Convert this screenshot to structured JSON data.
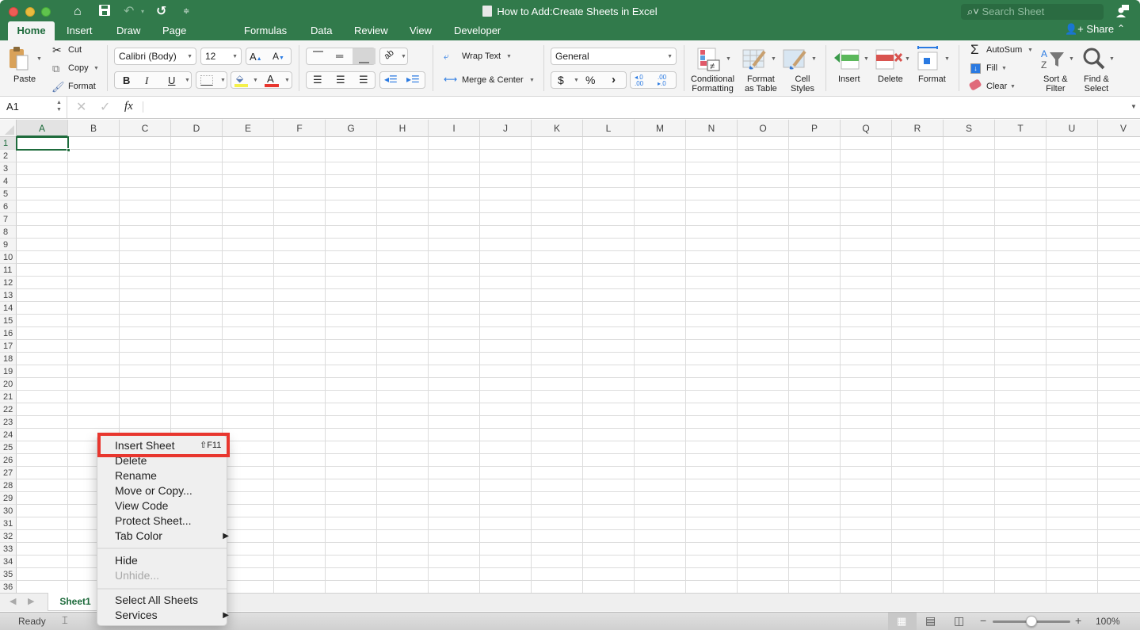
{
  "window": {
    "title": "How to Add:Create Sheets in Excel",
    "search_placeholder": "Search Sheet"
  },
  "quick_access": [
    "home-icon",
    "save-icon",
    "undo-icon",
    "redo-icon",
    "customize-icon"
  ],
  "tabs": [
    {
      "label": "Home",
      "active": true
    },
    {
      "label": "Insert"
    },
    {
      "label": "Draw"
    },
    {
      "label": "Page Layout"
    },
    {
      "label": "Formulas"
    },
    {
      "label": "Data"
    },
    {
      "label": "Review"
    },
    {
      "label": "View"
    },
    {
      "label": "Developer"
    }
  ],
  "share_label": "Share",
  "ribbon": {
    "paste": "Paste",
    "cut": "Cut",
    "copy": "Copy",
    "format_painter": "Format",
    "font_name": "Calibri (Body)",
    "font_size": "12",
    "bold": "B",
    "italic": "I",
    "underline": "U",
    "wrap_text": "Wrap Text",
    "merge_center": "Merge & Center",
    "number_format": "General",
    "currency": "$",
    "percent": "%",
    "comma": "›",
    "cond_format_1": "Conditional",
    "cond_format_2": "Formatting",
    "format_table_1": "Format",
    "format_table_2": "as Table",
    "cell_styles_1": "Cell",
    "cell_styles_2": "Styles",
    "insert": "Insert",
    "delete": "Delete",
    "format": "Format",
    "autosum": "AutoSum",
    "fill": "Fill",
    "clear": "Clear",
    "sort_1": "Sort &",
    "sort_2": "Filter",
    "find_1": "Find &",
    "find_2": "Select"
  },
  "formula_bar": {
    "name_box": "A1",
    "fx": "fx",
    "value": ""
  },
  "columns": [
    "A",
    "B",
    "C",
    "D",
    "E",
    "F",
    "G",
    "H",
    "I",
    "J",
    "K",
    "L",
    "M",
    "N",
    "O",
    "P",
    "Q",
    "R",
    "S",
    "T",
    "U",
    "V"
  ],
  "rows": 36,
  "selected_cell": "A1",
  "sheets": [
    {
      "name": "Sheet1",
      "active": true
    }
  ],
  "status": {
    "ready": "Ready",
    "zoom": "100%",
    "zoom_percent": 100
  },
  "context_menu": {
    "items": [
      {
        "label": "Insert Sheet",
        "shortcut": "⇧F11",
        "highlighted": true
      },
      {
        "label": "Delete"
      },
      {
        "label": "Rename"
      },
      {
        "label": "Move or Copy..."
      },
      {
        "label": "View Code"
      },
      {
        "label": "Protect Sheet..."
      },
      {
        "label": "Tab Color",
        "submenu": true
      },
      {
        "label": "Hide"
      },
      {
        "label": "Unhide...",
        "disabled": true
      },
      {
        "label": "Select All Sheets"
      },
      {
        "label": "Services",
        "submenu": true
      }
    ]
  },
  "colors": {
    "brand": "#317a4b",
    "highlight": "#e8362e",
    "selection": "#1e6b3c"
  }
}
